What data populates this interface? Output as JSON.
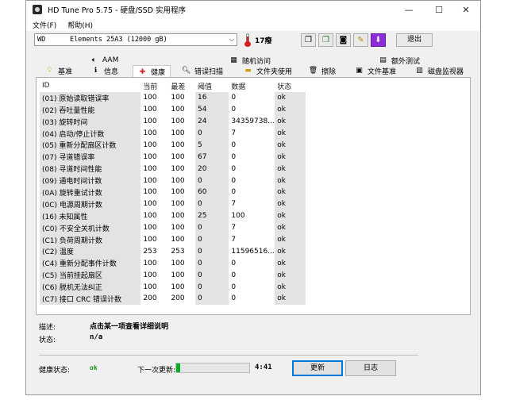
{
  "window": {
    "title": "HD Tune Pro 5.75 - 硬盘/SSD 实用程序",
    "minimize_icon": "—",
    "maximize_icon": "☐",
    "close_icon": "✕"
  },
  "menu": {
    "file": "文件(F)",
    "help": "帮助(H)"
  },
  "toolbar": {
    "drive": "WD      Elements 25A3 (12000 gB)",
    "temperature": "17癈",
    "exit_label": "退出"
  },
  "tabs_top": {
    "aam": "AAM",
    "random_access": "随机访问",
    "extra_tests": "额外测试"
  },
  "tabs_bottom": {
    "benchmark": "基准",
    "info": "信息",
    "health": "健康",
    "error_scan": "错误扫描",
    "file_usage": "文件夹使用",
    "erase": "擦除",
    "file_benchmark": "文件基准",
    "disk_monitor": "磁盘监视器"
  },
  "table": {
    "headers": [
      "ID",
      "当前",
      "最差",
      "阈值",
      "数据",
      "状态"
    ],
    "rows": [
      [
        "(01) 原始读取错误率",
        "100",
        "100",
        "16",
        "0",
        "ok"
      ],
      [
        "(02) 吞吐量性能",
        "100",
        "100",
        "54",
        "0",
        "ok"
      ],
      [
        "(03) 旋转时间",
        "100",
        "100",
        "24",
        "34359738...",
        "ok"
      ],
      [
        "(04) 启动/停止计数",
        "100",
        "100",
        "0",
        "7",
        "ok"
      ],
      [
        "(05) 重新分配扇区计数",
        "100",
        "100",
        "5",
        "0",
        "ok"
      ],
      [
        "(07) 寻道错误率",
        "100",
        "100",
        "67",
        "0",
        "ok"
      ],
      [
        "(08) 寻道时间性能",
        "100",
        "100",
        "20",
        "0",
        "ok"
      ],
      [
        "(09) 通电时间计数",
        "100",
        "100",
        "0",
        "0",
        "ok"
      ],
      [
        "(0A) 旋转重试计数",
        "100",
        "100",
        "60",
        "0",
        "ok"
      ],
      [
        "(0C) 电源周期计数",
        "100",
        "100",
        "0",
        "7",
        "ok"
      ],
      [
        "(16) 未知属性",
        "100",
        "100",
        "25",
        "100",
        "ok"
      ],
      [
        "(C0) 不安全关机计数",
        "100",
        "100",
        "0",
        "7",
        "ok"
      ],
      [
        "(C1) 负荷周期计数",
        "100",
        "100",
        "0",
        "7",
        "ok"
      ],
      [
        "(C2) 温度",
        "253",
        "253",
        "0",
        "11596516...",
        "ok"
      ],
      [
        "(C4) 重新分配事件计数",
        "100",
        "100",
        "0",
        "0",
        "ok"
      ],
      [
        "(C5) 当前挂起扇区",
        "100",
        "100",
        "0",
        "0",
        "ok"
      ],
      [
        "(C6) 脱机无法纠正",
        "100",
        "100",
        "0",
        "0",
        "ok"
      ],
      [
        "(C7) 接口 CRC 错误计数",
        "200",
        "200",
        "0",
        "0",
        "ok"
      ]
    ]
  },
  "details": {
    "desc_label": "描述:",
    "desc_value": "点击某一项查看详细说明",
    "status_label": "状态:",
    "status_value": "n/a"
  },
  "bottom": {
    "health_label": "健康状态:",
    "health_value": "ok",
    "next_update_label": "下一次更新:",
    "progress_fraction": 0.05,
    "countdown": "4:41",
    "refresh_label": "更新",
    "log_label": "日志"
  },
  "colors": {
    "progress": "#06b025",
    "health_ok": "#1a8a1a",
    "health_tab_icon": "#d81b1b",
    "grey_column": "#e3e3e3"
  }
}
